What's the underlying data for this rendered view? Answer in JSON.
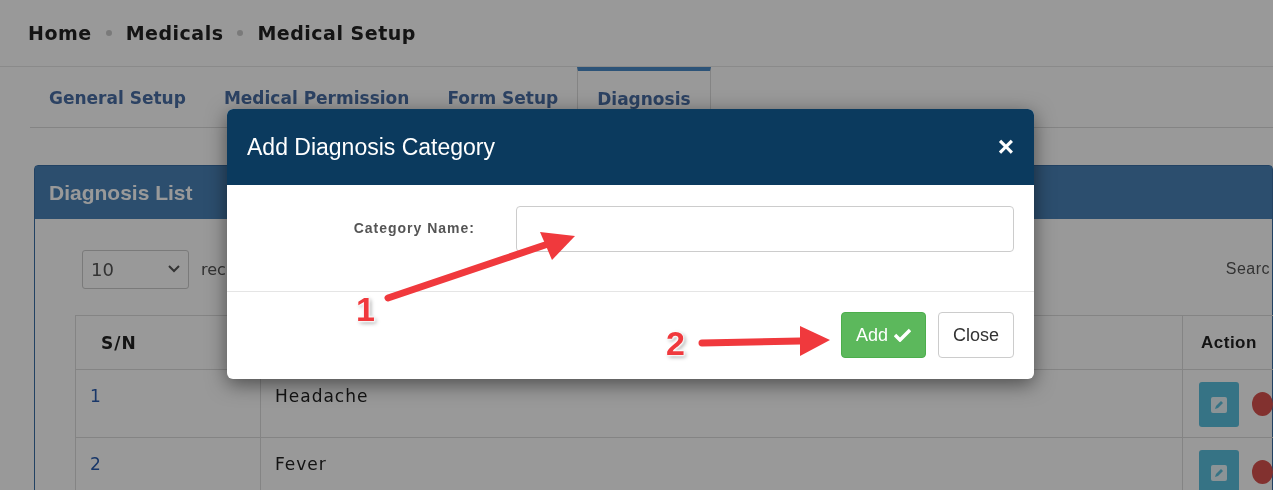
{
  "breadcrumb": [
    "Home",
    "Medicals",
    "Medical Setup"
  ],
  "tabs": [
    {
      "label": "General Setup",
      "selected": false
    },
    {
      "label": "Medical Permission",
      "selected": false
    },
    {
      "label": "Form Setup",
      "selected": false
    },
    {
      "label": "Diagnosis",
      "selected": true
    }
  ],
  "card": {
    "title": "Diagnosis List",
    "page_size": "10",
    "page_size_suffix": "rec",
    "search_label": "Searc",
    "table": {
      "columns": [
        "S/N",
        "",
        "Action"
      ],
      "rows": [
        {
          "sn": "1",
          "name": "Headache"
        },
        {
          "sn": "2",
          "name": "Fever"
        }
      ]
    }
  },
  "modal": {
    "title": "Add Diagnosis Category",
    "close_icon": "×",
    "field_label": "Category Name:",
    "buttons": [
      {
        "label": "Add",
        "kind": "primary"
      },
      {
        "label": "Close",
        "kind": "default"
      }
    ]
  },
  "annotations": [
    "1",
    "2"
  ]
}
